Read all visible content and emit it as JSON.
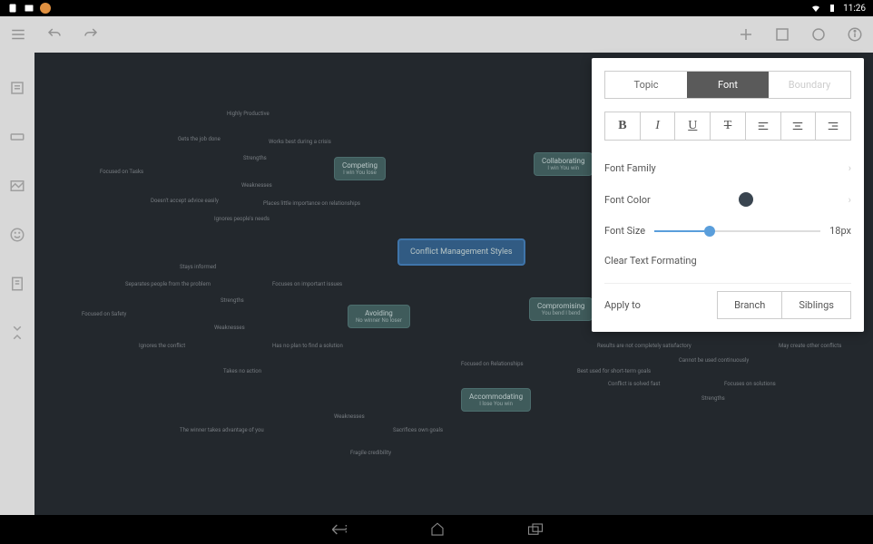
{
  "statusbar": {
    "time": "11:26"
  },
  "panel": {
    "tabs": {
      "topic": "Topic",
      "font": "Font",
      "boundary": "Boundary"
    },
    "format_buttons": [
      "B",
      "I",
      "U",
      "T"
    ],
    "font_family_label": "Font Family",
    "font_color_label": "Font Color",
    "font_color_value": "#3a4550",
    "font_size_label": "Font Size",
    "font_size_value": "18px",
    "clear_label": "Clear Text Formating",
    "apply_label": "Apply to",
    "apply_branch": "Branch",
    "apply_siblings": "Siblings"
  },
  "mindmap": {
    "central": "Conflict Management Styles",
    "nodes": {
      "competing": {
        "title": "Competing",
        "subtitle": "I win You lose"
      },
      "collaborating": {
        "title": "Collaborating",
        "subtitle": "I win You win"
      },
      "avoiding": {
        "title": "Avoiding",
        "subtitle": "No winner No loser"
      },
      "compromising": {
        "title": "Compromising",
        "subtitle": "You bend I bend"
      },
      "accommodating": {
        "title": "Accommodating",
        "subtitle": "I lose You win"
      }
    },
    "labels": {
      "highly_productive": "Highly Productive",
      "gets_job_done": "Gets the job done",
      "works_best_crisis": "Works best during a crisis",
      "strengths1": "Strengths",
      "focused_tasks": "Focused on Tasks",
      "weaknesses1": "Weaknesses",
      "doesnt_accept": "Doesn't accept advice easily",
      "places_importance": "Places little importance on relationships",
      "ignores_needs": "Ignores people's needs",
      "stays_informed": "Stays informed",
      "separates_people": "Separates people from the problem",
      "focuses_issues": "Focuses on important issues",
      "strengths2": "Strengths",
      "focused_safety": "Focused on Safety",
      "weaknesses2": "Weaknesses",
      "ignores_conflict": "Ignores the conflict",
      "no_plan": "Has no plan to find a solution",
      "takes_no_action": "Takes no action",
      "focused_relationships": "Focused on Relationships",
      "weaknesses3": "Weaknesses",
      "winner_advantage": "The winner takes advantage of you",
      "sacrifices_goals": "Sacrifices own goals",
      "fragile_credibility": "Fragile credibility",
      "results_not_satisfactory": "Results are not completely satisfactory",
      "best_short_term": "Best used for short-term goals",
      "conflict_solved_fast": "Conflict is solved fast",
      "strengths3": "Strengths",
      "may_create_conflicts": "May create other conflicts",
      "cannot_be_used": "Cannot be used continuously",
      "focuses_solutions": "Focuses on solutions"
    }
  }
}
